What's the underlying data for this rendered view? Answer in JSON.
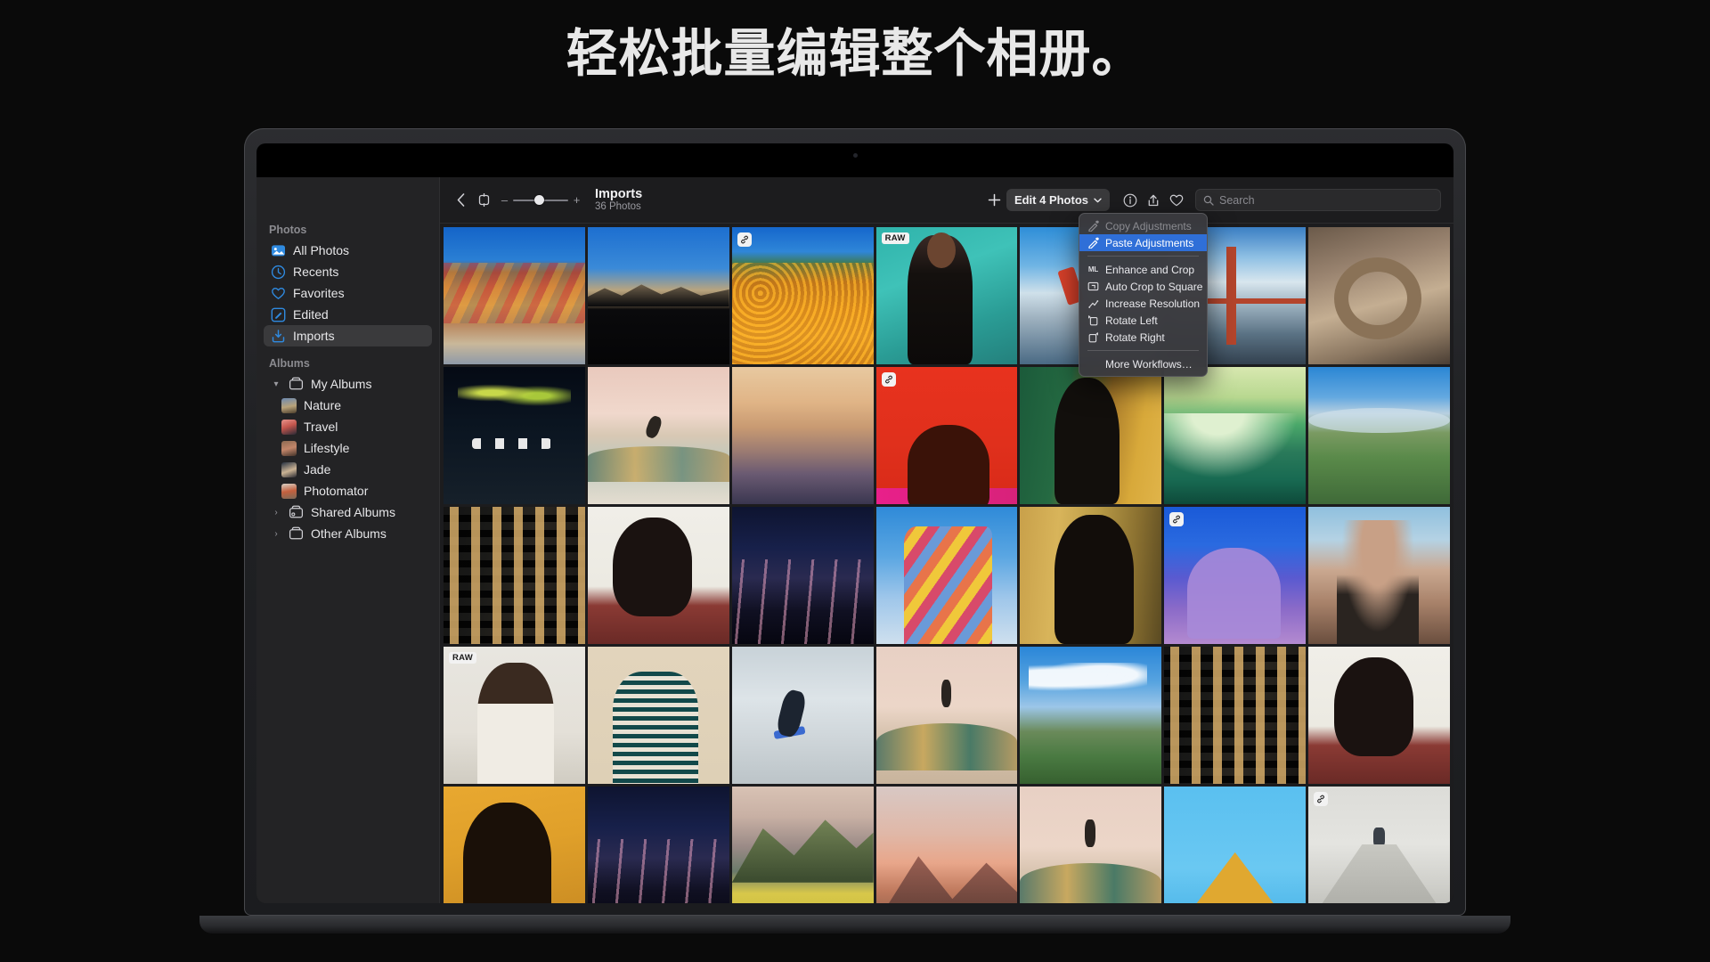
{
  "headline": "轻松批量编辑整个相册。",
  "sidebar": {
    "sections": [
      {
        "title": "Photos",
        "items": [
          {
            "label": "All Photos",
            "icon": "all-photos-icon",
            "selected": false
          },
          {
            "label": "Recents",
            "icon": "clock-icon",
            "selected": false
          },
          {
            "label": "Favorites",
            "icon": "heart-icon",
            "selected": false
          },
          {
            "label": "Edited",
            "icon": "edited-icon",
            "selected": false
          },
          {
            "label": "Imports",
            "icon": "import-icon",
            "selected": true
          }
        ]
      },
      {
        "title": "Albums",
        "items": [
          {
            "label": "My Albums",
            "icon": "album-icon",
            "disclosure": "▾",
            "selected": false
          },
          {
            "label": "Nature",
            "icon": "thumb-nature",
            "sub": true,
            "selected": false
          },
          {
            "label": "Travel",
            "icon": "thumb-travel",
            "sub": true,
            "selected": false
          },
          {
            "label": "Lifestyle",
            "icon": "thumb-lifestyle",
            "sub": true,
            "selected": false
          },
          {
            "label": "Jade",
            "icon": "thumb-jade",
            "sub": true,
            "selected": false
          },
          {
            "label": "Photomator",
            "icon": "thumb-photomator",
            "sub": true,
            "selected": false
          },
          {
            "label": "Shared Albums",
            "icon": "shared-album-icon",
            "disclosure": "›",
            "selected": false
          },
          {
            "label": "Other Albums",
            "icon": "album-icon",
            "disclosure": "›",
            "selected": false
          }
        ]
      }
    ]
  },
  "toolbar": {
    "back_icon": "chevron-left-icon",
    "sidebar_toggle_icon": "panel-toggle-icon",
    "zoom_minus": "–",
    "zoom_plus": "+",
    "title": "Imports",
    "subtitle": "36 Photos",
    "add_icon": "plus-icon",
    "edit_button_label": "Edit 4 Photos",
    "edit_button_chevron": "⌄",
    "info_icon": "info-icon",
    "share_icon": "share-icon",
    "favorite_icon": "heart-icon",
    "search_icon": "search-icon",
    "search_placeholder": "Search",
    "search_value": ""
  },
  "menu": {
    "items": [
      {
        "label": "Copy Adjustments",
        "icon": "eyedropper-icon",
        "state": "disabled"
      },
      {
        "label": "Paste Adjustments",
        "icon": "eyedropper-fill-icon",
        "state": "highlighted"
      },
      {
        "separator": true
      },
      {
        "label": "Enhance and Crop",
        "icon": "ml-icon",
        "state": "normal"
      },
      {
        "label": "Auto Crop to Square",
        "icon": "crop-square-icon",
        "state": "normal"
      },
      {
        "label": "Increase Resolution",
        "icon": "resolution-icon",
        "state": "normal"
      },
      {
        "label": "Rotate Left",
        "icon": "rotate-left-icon",
        "state": "normal"
      },
      {
        "label": "Rotate Right",
        "icon": "rotate-right-icon",
        "state": "normal"
      },
      {
        "separator": true
      },
      {
        "label": "More Workflows…",
        "icon": "",
        "state": "normal"
      }
    ]
  },
  "colors": {
    "accent_blue": "#1473e6",
    "menu_highlight": "#2f6fd8",
    "sidebar_bg": "#232325",
    "app_bg": "#1c1c1e",
    "selection_border": "#1473e6"
  },
  "grid": {
    "columns": 7,
    "cells": [
      {
        "art": "p-rainbow",
        "alt": "rainbow-mountains",
        "badge": null,
        "selected": false
      },
      {
        "art": "p-darkmtn",
        "alt": "dark-mountain-night",
        "badge": null,
        "selected": false
      },
      {
        "art": "p-poppy",
        "alt": "poppy-field",
        "badge": "link",
        "selected": false
      },
      {
        "art": "p-teal",
        "alt": "portrait-teal-wall",
        "badge": "RAW",
        "selected": true
      },
      {
        "art": "p-surf",
        "alt": "windsurfer",
        "badge": null,
        "selected": false
      },
      {
        "art": "p-bridge",
        "alt": "golden-gate-bridge",
        "badge": null,
        "selected": false
      },
      {
        "art": "p-arch",
        "alt": "rock-arch",
        "badge": null,
        "selected": false
      },
      {
        "art": "p-boats",
        "alt": "boats-aerial",
        "badge": null,
        "selected": false
      },
      {
        "art": "p-skate1",
        "alt": "skate-bowl-desert",
        "badge": null,
        "selected": false
      },
      {
        "art": "p-dune",
        "alt": "dune-sunset",
        "badge": null,
        "selected": false
      },
      {
        "art": "p-red",
        "alt": "silhouette-red",
        "badge": "link",
        "selected": false
      },
      {
        "art": "p-green",
        "alt": "silhouette-green",
        "badge": null,
        "selected": false
      },
      {
        "art": "p-wave",
        "alt": "surfer-wave",
        "badge": null,
        "selected": false
      },
      {
        "art": "p-hills",
        "alt": "green-hills-sky",
        "badge": null,
        "selected": false
      },
      {
        "art": "p-bldg",
        "alt": "building-facade",
        "badge": null,
        "selected": false
      },
      {
        "art": "p-prof1",
        "alt": "profile-white-bg",
        "badge": null,
        "selected": false
      },
      {
        "art": "p-night",
        "alt": "grass-night-sky",
        "badge": null,
        "selected": false
      },
      {
        "art": "p-quilt",
        "alt": "quilt-coat-sky",
        "badge": null,
        "selected": false
      },
      {
        "art": "p-curl",
        "alt": "curly-hair-profile",
        "badge": null,
        "selected": false
      },
      {
        "art": "p-blue",
        "alt": "blue-sculpture",
        "badge": "link",
        "selected": false
      },
      {
        "art": "p-portr",
        "alt": "portrait-outdoor",
        "badge": null,
        "selected": false
      },
      {
        "art": "p-raw1",
        "alt": "white-suit-portrait",
        "badge": "RAW",
        "selected": false
      },
      {
        "art": "p-stripe",
        "alt": "striped-top-shadow",
        "badge": null,
        "selected": false
      },
      {
        "art": "p-skate2",
        "alt": "skateboarder-bowl",
        "badge": null,
        "selected": true
      },
      {
        "art": "p-ramp",
        "alt": "skate-ramp-mural",
        "badge": null,
        "selected": false
      },
      {
        "art": "p-sky",
        "alt": "hills-clouds",
        "badge": null,
        "selected": true
      },
      {
        "art": "p-bldg",
        "alt": "building-facade-2",
        "badge": null,
        "selected": false
      },
      {
        "art": "p-prof1",
        "alt": "profile-white-bg-2",
        "badge": null,
        "selected": false
      },
      {
        "art": "p-silho",
        "alt": "afro-silhouette",
        "badge": null,
        "selected": false
      },
      {
        "art": "p-night",
        "alt": "grass-night-sky-2",
        "badge": null,
        "selected": false
      },
      {
        "art": "p-peak",
        "alt": "ridge-yellow-flowers",
        "badge": null,
        "selected": false
      },
      {
        "art": "p-pink",
        "alt": "pink-peak",
        "badge": null,
        "selected": false
      },
      {
        "art": "p-ramp",
        "alt": "skate-ramp-mural-2",
        "badge": null,
        "selected": false
      },
      {
        "art": "p-cyan",
        "alt": "yellow-pyramid-sky",
        "badge": null,
        "selected": false
      },
      {
        "art": "p-stair",
        "alt": "white-stairs",
        "badge": "link",
        "selected": false
      }
    ]
  }
}
